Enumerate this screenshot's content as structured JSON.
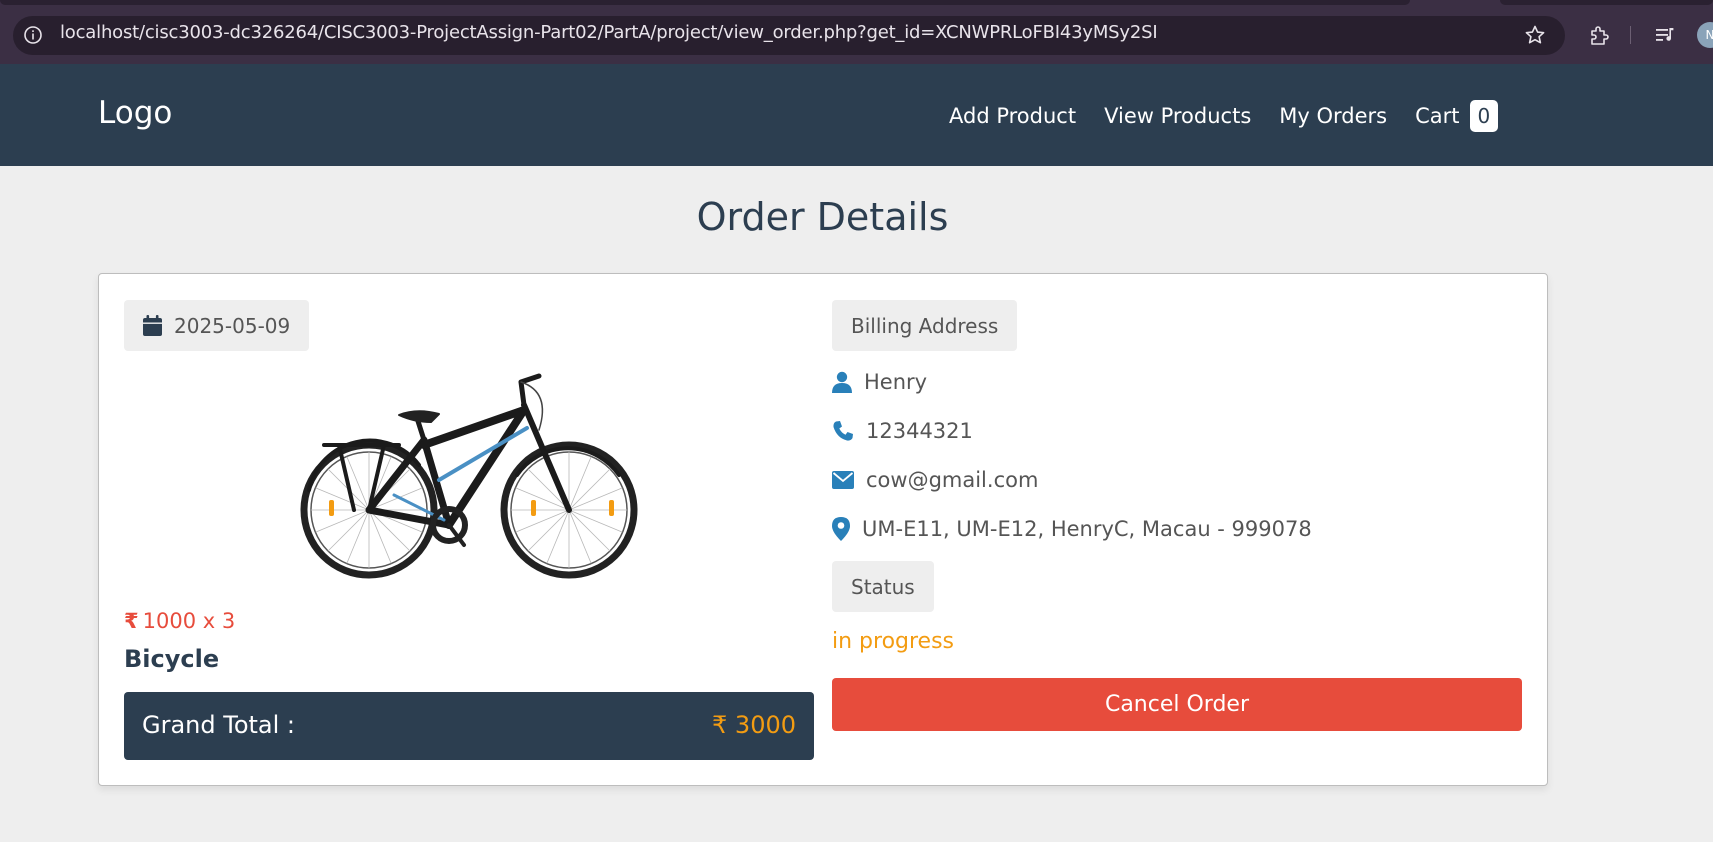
{
  "browser": {
    "url": "localhost/cisc3003-dc326264/CISC3003-ProjectAssign-Part02/PartA/project/view_order.php?get_id=XCNWPRLoFBI43yMSy2SI",
    "profile_initial": "N"
  },
  "header": {
    "logo": "Logo",
    "nav": {
      "add_product": "Add Product",
      "view_products": "View Products",
      "my_orders": "My Orders",
      "cart": "Cart",
      "cart_count": "0"
    }
  },
  "page": {
    "title": "Order Details"
  },
  "order": {
    "date": "2025-05-09",
    "price_text": "1000 x 3",
    "currency_symbol": "₹",
    "product_name": "Bicycle",
    "grand_total_label": "Grand Total :",
    "grand_total_value": "3000",
    "billing_label": "Billing Address",
    "name": "Henry",
    "phone": "12344321",
    "email": "cow@gmail.com",
    "address": "UM-E11, UM-E12, HenryC, Macau - 999078",
    "status_label": "Status",
    "status_value": "in progress",
    "cancel_label": "Cancel Order"
  },
  "colors": {
    "header_bg": "#2c3e50",
    "accent_red": "#e74c3c",
    "accent_orange": "#f39c12",
    "icon_blue": "#2980b9",
    "page_bg": "#eeeeee"
  },
  "icons": {
    "date": "calendar-icon",
    "name": "user-icon",
    "phone": "phone-icon",
    "email": "envelope-icon",
    "address": "map-marker-icon"
  }
}
